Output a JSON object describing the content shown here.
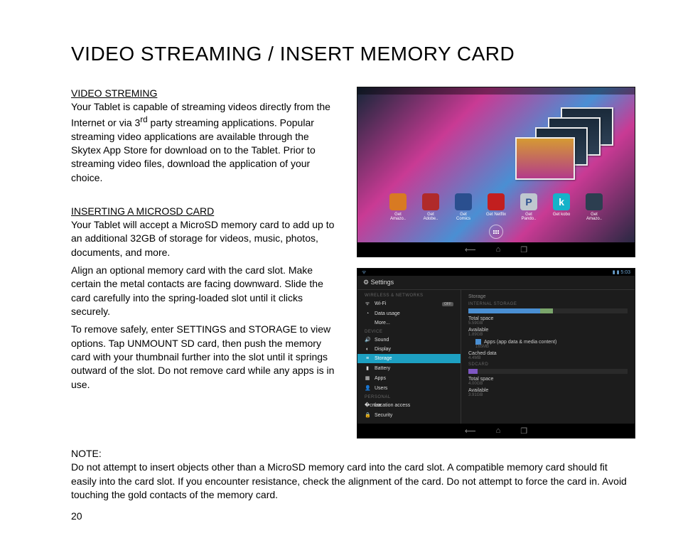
{
  "page": {
    "title": "VIDEO STREAMING / INSERT MEMORY CARD",
    "page_number": "20"
  },
  "sections": {
    "video_streaming": {
      "heading": "VIDEO STREMING",
      "body_before_sup": "Your Tablet is capable of streaming videos directly from the Internet or via 3",
      "sup": "rd",
      "body_after_sup": " party streaming applications. Popular streaming video applications are available through the Skytex App Store for download on to the Tablet. Prior to streaming video files, download the application of your choice."
    },
    "microsd": {
      "heading": "INSERTING A MICROSD CARD",
      "p1": "Your Tablet will accept a MicroSD memory card to add up to an additional 32GB of storage for videos, music, photos, documents, and more.",
      "p2": "Align an optional memory card with the card slot. Make certain the metal contacts are facing downward. Slide the card carefully into the spring-loaded slot until it clicks securely.",
      "p3": "To remove safely, enter SETTINGS and STORAGE to view options. Tap UNMOUNT SD card, then push the memory card with your thumbnail further into the slot until it springs outward of the slot. Do not remove card while any apps is in use."
    },
    "note": {
      "heading": "NOTE:",
      "body": "Do not attempt to insert objects other than a MicroSD memory card into the card slot. A compatible memory card should fit easily into the card slot. If you encounter resistance, check the alignment of the card. Do not attempt to force the card in. Avoid touching the gold contacts of the memory card."
    }
  },
  "screenshot_home": {
    "app_icons": [
      {
        "label": "Get Amazo..",
        "color": "#d87a22"
      },
      {
        "label": "Get Adobe..",
        "color": "#b02a2a"
      },
      {
        "label": "Get Comics",
        "color": "#2a4f8f"
      },
      {
        "label": "Get Netflix",
        "color": "#c21f1f"
      },
      {
        "label": "Get Pando..",
        "color": "#bfc7cf"
      },
      {
        "label": "Get kobo",
        "color": "#16b2c9"
      },
      {
        "label": "Get Amazo..",
        "color": "#2c3e50"
      }
    ]
  },
  "screenshot_settings": {
    "title": "Settings",
    "left": {
      "cat_wireless": "WIRELESS & NETWORKS",
      "wifi": "Wi-Fi",
      "wifi_state": "OFF",
      "data_usage": "Data usage",
      "more": "More...",
      "cat_device": "DEVICE",
      "sound": "Sound",
      "display": "Display",
      "storage": "Storage",
      "battery": "Battery",
      "apps": "Apps",
      "users": "Users",
      "cat_personal": "PERSONAL",
      "location": "Location access",
      "security": "Security"
    },
    "right": {
      "header": "Storage",
      "cat_internal": "INTERNAL STORAGE",
      "total_label": "Total space",
      "total_value": "5.59GB",
      "avail_label": "Available",
      "avail_value": "1.89GB",
      "apps_label": "Apps (app data & media content)",
      "apps_value": "165MB",
      "cached_label": "Cached data",
      "cached_value": "4.4MB",
      "cat_sdcard": "SDCARD",
      "sd_total_label": "Total space",
      "sd_total_value": "4.00GB",
      "sd_avail_label": "Available",
      "sd_avail_value": "3.91GB"
    }
  }
}
